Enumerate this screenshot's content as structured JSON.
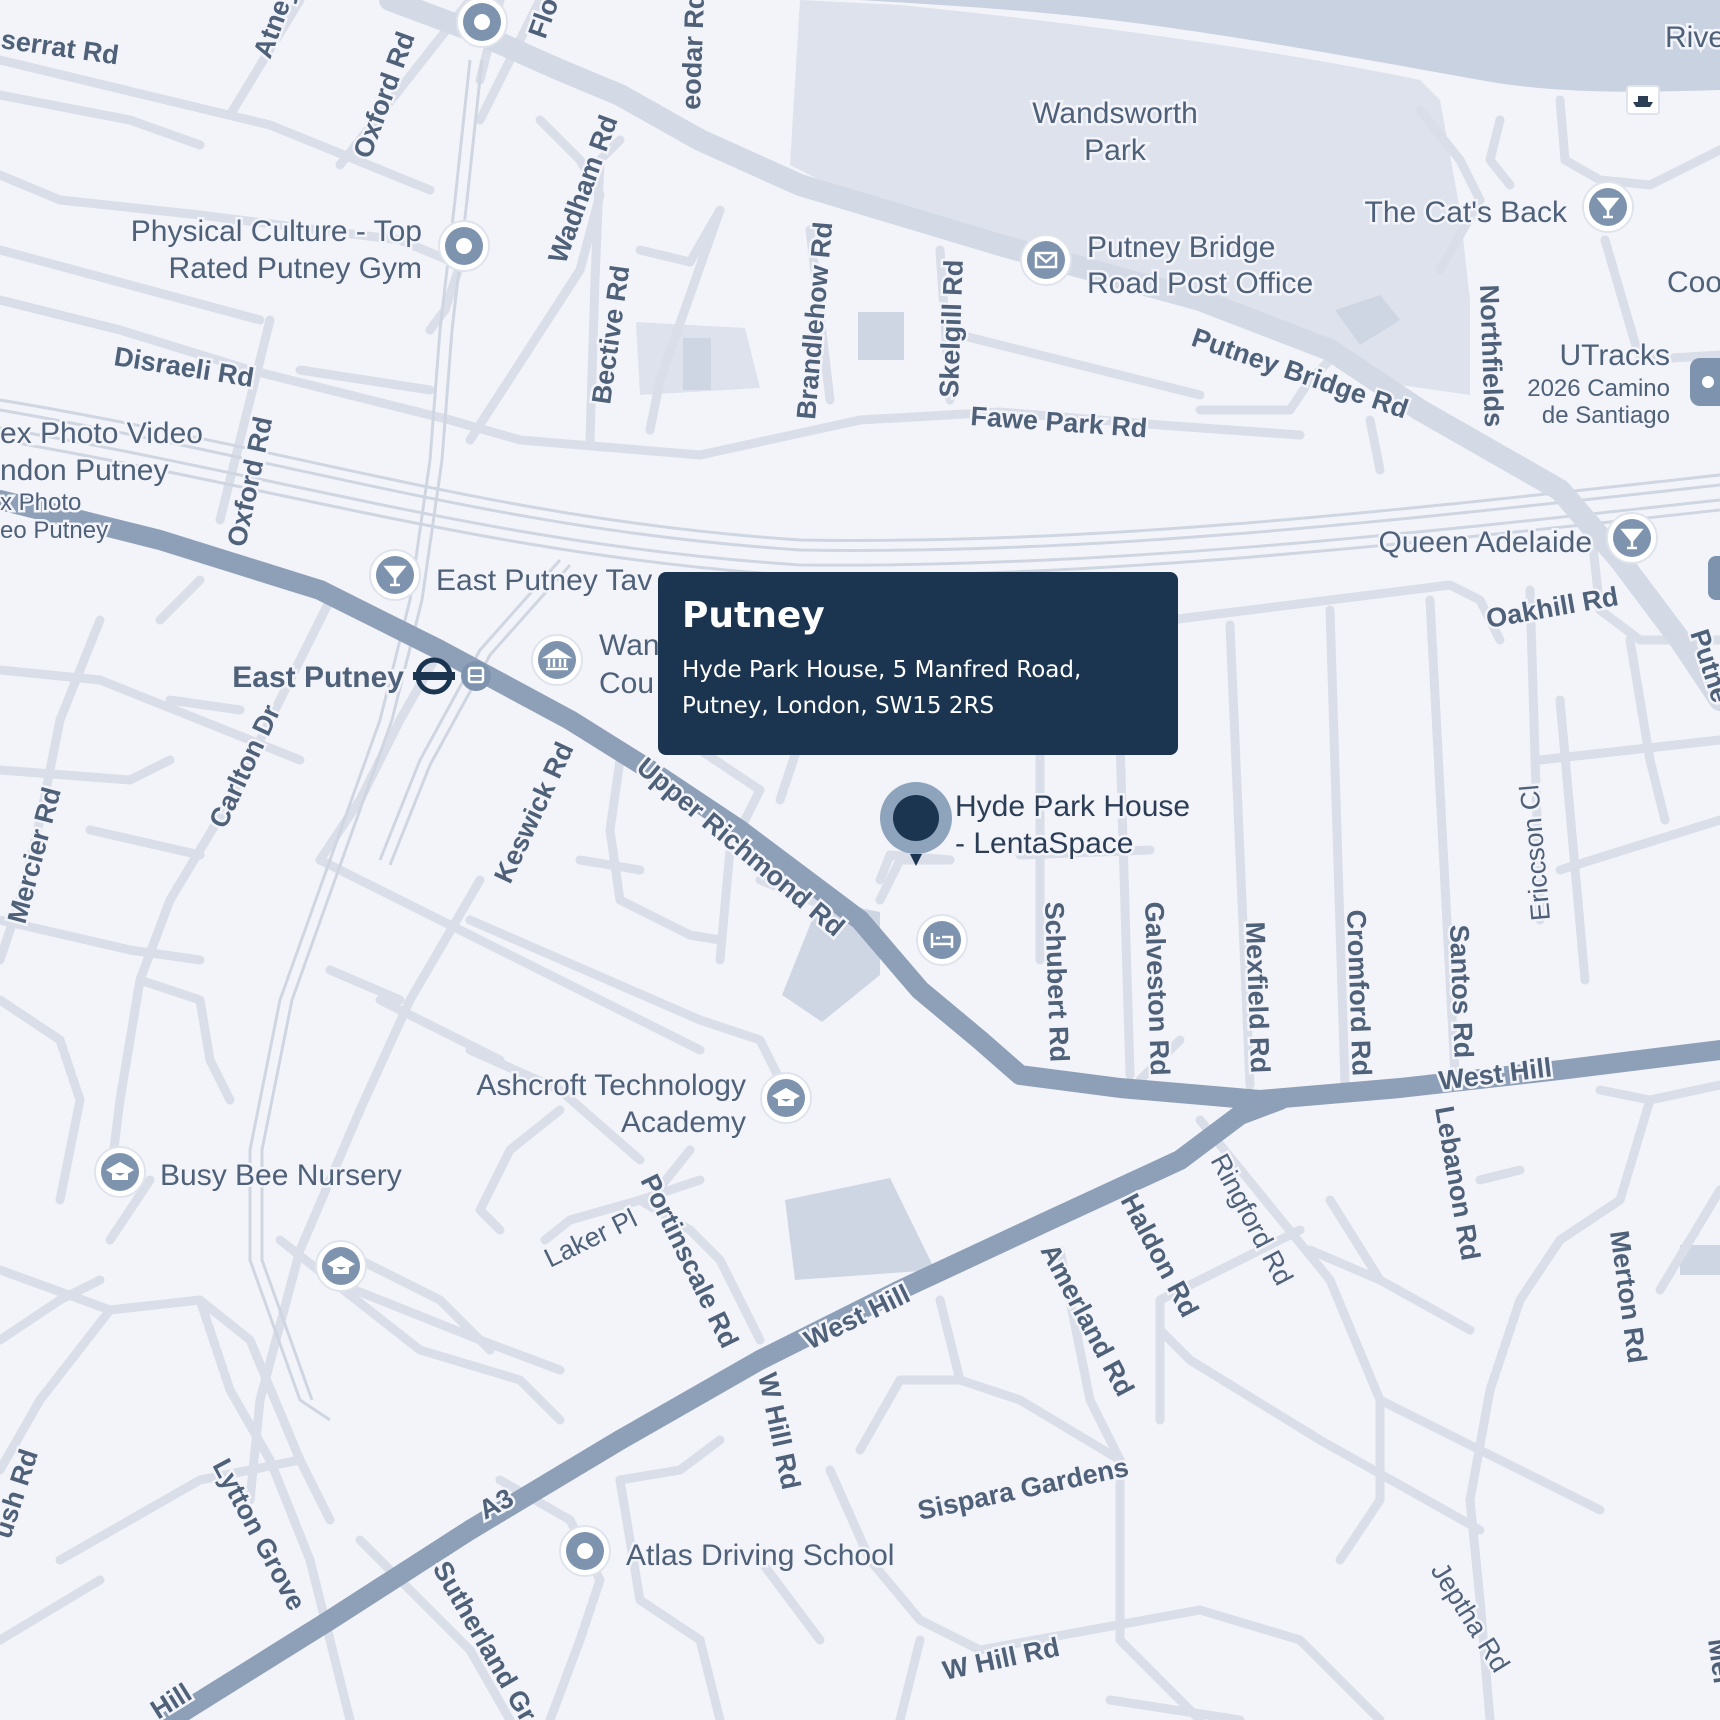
{
  "map": {
    "colors": {
      "background": "#f3f4f9",
      "park": "#dde2ec",
      "water": "#c9d2e0",
      "major_road": "#8ea0b8",
      "minor_road": "#d9dee8",
      "label": "#4e6179",
      "pin_dark": "#1b3550",
      "pin_ring": "#7e93ad"
    },
    "info_card": {
      "title": "Putney",
      "address_line1": "Hyde Park House, 5 Manfred Road,",
      "address_line2": "Putney, London, SW15 2RS"
    },
    "main_marker": {
      "label_line1": "Hyde Park House",
      "label_line2": "- LentaSpace",
      "icon": "location-pin-icon"
    },
    "roads": {
      "serrat": "serrat Rd",
      "atney": "Atney",
      "flo": "Flo",
      "eodar": "eodar Rd",
      "oxford_top": "Oxford Rd",
      "wadham": "Wadham Rd",
      "bective": "Bective Rd",
      "brandlehow": "Brandlehow Rd",
      "skelgill": "Skelgill Rd",
      "disraeli": "Disraeli Rd",
      "oxford_mid": "Oxford Rd",
      "fawe_park": "Fawe Park Rd",
      "putney_bridge": "Putney Bridge Rd",
      "northfields": "Northfields",
      "oakhill": "Oakhill Rd",
      "putney_edge": "Putne",
      "carlton": "Carlton Dr",
      "mercier": "Mercier Rd",
      "keswick": "Keswick Rd",
      "upper_richmond": "Upper Richmond Rd",
      "schubert": "Schubert Rd",
      "galveston": "Galveston Rd",
      "mexfield": "Mexfield Rd",
      "cromford": "Cromford Rd",
      "santos": "Santos Rd",
      "ericcson": "Ericcson Cl",
      "west_hill_east": "West Hill",
      "lebanon": "Lebanon Rd",
      "ringford": "Ringford Rd",
      "haldon": "Haldon Rd",
      "amerland": "Amerland Rd",
      "merton": "Merton Rd",
      "laker": "Laker Pl",
      "portinscale": "Portinscale Rd",
      "west_hill_center": "West Hill",
      "w_hill_rd": "W Hill Rd",
      "a3": "A3",
      "sispara": "Sispara Gardens",
      "lytton": "Lytton Grove",
      "ush": "ush Rd",
      "sutherland": "Sutherland Gr",
      "w_hill_rd_south": "W Hill Rd",
      "jeptha": "Jeptha Rd",
      "hill_edge": "Hill",
      "mer_edge": "Mer"
    },
    "places": {
      "wandsworth_park_1": "Wandsworth",
      "wandsworth_park_2": "Park",
      "physical_culture_1": "Physical Culture - Top",
      "physical_culture_2": "Rated Putney Gym",
      "cats_back": "The Cat's Back",
      "post_office_1": "Putney Bridge",
      "post_office_2": "Road Post Office",
      "utracks_1": "UTracks",
      "utracks_2": "2026 Camino",
      "utracks_3": "de Santiago",
      "coo": "Coo",
      "rive": "Rive",
      "photo_1": "ex Photo Video",
      "photo_2": "ndon Putney",
      "photo_3": "x Photo",
      "photo_4": "eo Putney",
      "queen_adelaide": "Queen Adelaide",
      "east_putney_tav": "East Putney Tav",
      "east_putney": "East Putney",
      "wan_1": "Wan",
      "wan_2": "Cou",
      "ashcroft_1": "Ashcroft Technology",
      "ashcroft_2": "Academy",
      "busy_bee": "Busy Bee Nursery",
      "atlas": "Atlas Driving School"
    }
  }
}
